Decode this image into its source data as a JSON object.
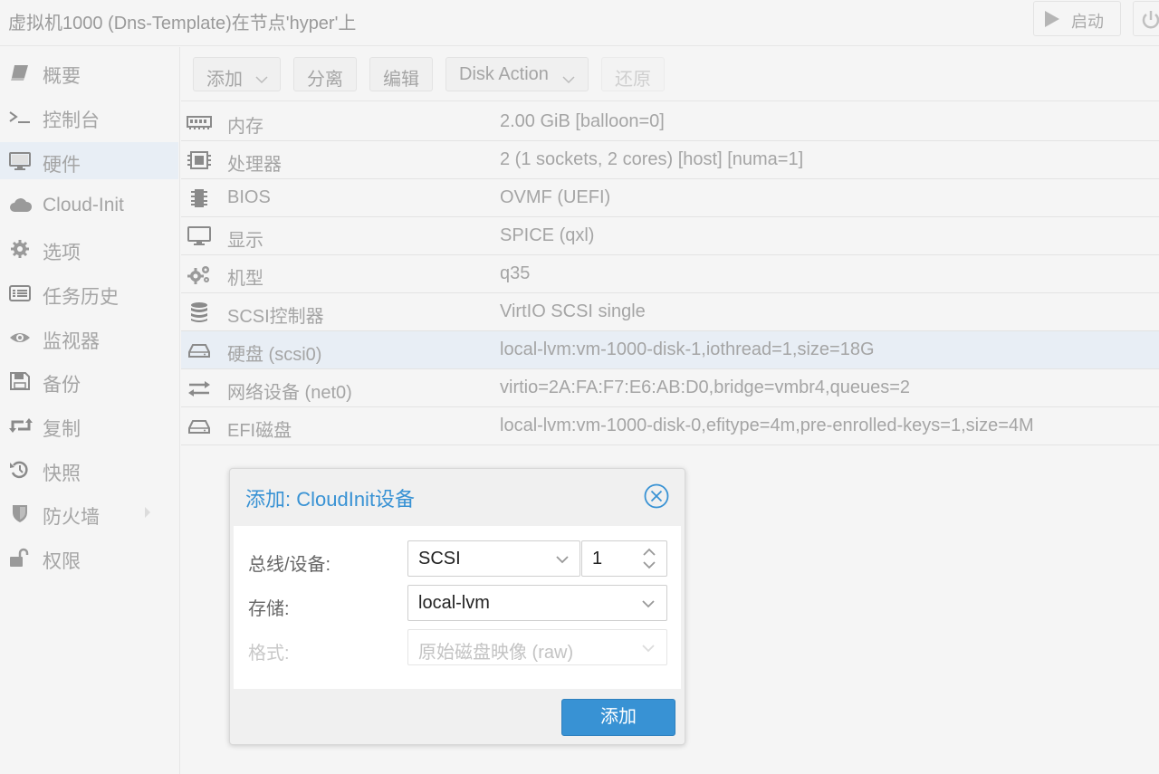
{
  "header": {
    "title": "虚拟机1000 (Dns-Template)在节点'hyper'上",
    "start_label": "启动"
  },
  "sidebar": {
    "items": [
      {
        "label": "概要",
        "icon": "book-icon"
      },
      {
        "label": "控制台",
        "icon": "terminal-icon"
      },
      {
        "label": "硬件",
        "icon": "desktop-icon"
      },
      {
        "label": "Cloud-Init",
        "icon": "cloud-icon"
      },
      {
        "label": "选项",
        "icon": "gear-icon"
      },
      {
        "label": "任务历史",
        "icon": "list-icon"
      },
      {
        "label": "监视器",
        "icon": "eye-icon"
      },
      {
        "label": "备份",
        "icon": "floppy-icon"
      },
      {
        "label": "复制",
        "icon": "retweet-icon"
      },
      {
        "label": "快照",
        "icon": "history-icon"
      },
      {
        "label": "防火墙",
        "icon": "shield-icon"
      },
      {
        "label": "权限",
        "icon": "unlock-icon"
      }
    ],
    "active_index": 2
  },
  "toolbar": {
    "add_label": "添加",
    "detach_label": "分离",
    "edit_label": "编辑",
    "disk_action_label": "Disk Action",
    "revert_label": "还原"
  },
  "hardware": [
    {
      "name": "内存",
      "value": "2.00 GiB [balloon=0]",
      "icon": "memory-icon"
    },
    {
      "name": "处理器",
      "value": "2 (1 sockets, 2 cores) [host] [numa=1]",
      "icon": "cpu-icon"
    },
    {
      "name": "BIOS",
      "value": "OVMF (UEFI)",
      "icon": "microchip-icon"
    },
    {
      "name": "显示",
      "value": "SPICE (qxl)",
      "icon": "display-icon"
    },
    {
      "name": "机型",
      "value": "q35",
      "icon": "cogs-icon"
    },
    {
      "name": "SCSI控制器",
      "value": "VirtIO SCSI single",
      "icon": "database-icon"
    },
    {
      "name": "硬盘 (scsi0)",
      "value": "local-lvm:vm-1000-disk-1,iothread=1,size=18G",
      "icon": "hdd-icon"
    },
    {
      "name": "网络设备 (net0)",
      "value": "virtio=2A:FA:F7:E6:AB:D0,bridge=vmbr4,queues=2",
      "icon": "exchange-icon"
    },
    {
      "name": "EFI磁盘",
      "value": "local-lvm:vm-1000-disk-0,efitype=4m,pre-enrolled-keys=1,size=4M",
      "icon": "hdd-icon"
    }
  ],
  "selected_row": 6,
  "dialog": {
    "title": "添加: CloudInit设备",
    "bus_label": "总线/设备:",
    "bus_value": "SCSI",
    "device_value": "1",
    "storage_label": "存储:",
    "storage_value": "local-lvm",
    "format_label": "格式:",
    "format_value": "原始磁盘映像 (raw)",
    "add_button": "添加"
  },
  "colors": {
    "accent": "#3892d4",
    "selected_bg": "#e8eef5",
    "muted_text": "#a5a5a5"
  }
}
